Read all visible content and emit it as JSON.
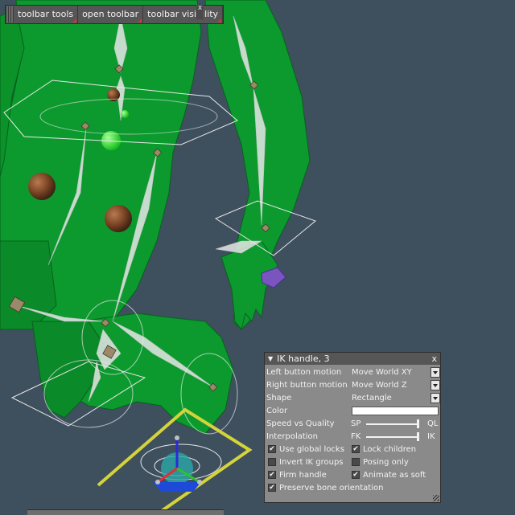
{
  "toolbar": {
    "items": [
      "toolbar tools",
      "open toolbar",
      "toolbar visibility"
    ],
    "close_glyph": "x"
  },
  "ik_panel": {
    "title": "IK handle, 3",
    "collapse_icon": "triangle-down-icon",
    "close_glyph": "x",
    "left_button_motion": {
      "label": "Left button motion",
      "value": "Move World XY"
    },
    "right_button_motion": {
      "label": "Right button motion",
      "value": "Move World Z"
    },
    "shape": {
      "label": "Shape",
      "value": "Rectangle"
    },
    "color": {
      "label": "Color",
      "value": "#ffffff"
    },
    "speed_vs_quality": {
      "label": "Speed vs Quality",
      "left": "SP",
      "right": "QL",
      "level": 1.0
    },
    "interpolation": {
      "label": "Interpolation",
      "left": "FK",
      "right": "IK",
      "level": 1.0
    },
    "checkboxes": [
      {
        "label": "Use global locks",
        "checked": true
      },
      {
        "label": "Lock children",
        "checked": true
      },
      {
        "label": "Invert IK groups",
        "checked": false
      },
      {
        "label": "Posing only",
        "checked": false
      },
      {
        "label": "Firm handle",
        "checked": true
      },
      {
        "label": "Animate as soft",
        "checked": true
      },
      {
        "label": "Preserve bone orientation",
        "checked": true
      }
    ]
  },
  "colors": {
    "background": "#3e4f5e",
    "mesh": "#0c9a2e",
    "bones": "#dcdcdc",
    "handle_frame": "#c8c83a"
  }
}
